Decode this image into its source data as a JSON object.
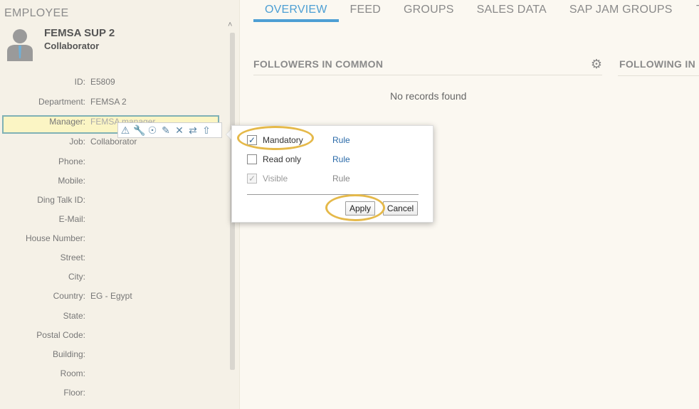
{
  "employee": {
    "section_title": "EMPLOYEE",
    "name": "FEMSA SUP 2",
    "role": "Collaborator",
    "fields": [
      {
        "label": "ID:",
        "value": "E5809"
      },
      {
        "label": "Department:",
        "value": "FEMSA 2"
      },
      {
        "label": "Manager:",
        "value": "FEMSA manager"
      },
      {
        "label": "Job:",
        "value": "Collaborator"
      },
      {
        "label": "Phone:",
        "value": ""
      },
      {
        "label": "Mobile:",
        "value": ""
      },
      {
        "label": "Ding Talk ID:",
        "value": ""
      },
      {
        "label": "E-Mail:",
        "value": ""
      },
      {
        "label": "House Number:",
        "value": ""
      },
      {
        "label": "Street:",
        "value": ""
      },
      {
        "label": "City:",
        "value": ""
      },
      {
        "label": "Country:",
        "value": "EG - Egypt"
      },
      {
        "label": "State:",
        "value": ""
      },
      {
        "label": "Postal Code:",
        "value": ""
      },
      {
        "label": "Building:",
        "value": ""
      },
      {
        "label": "Room:",
        "value": ""
      },
      {
        "label": "Floor:",
        "value": ""
      }
    ]
  },
  "toolbar_icons": [
    "warning-icon",
    "wrench-icon",
    "target-icon",
    "pencil-icon",
    "delete-icon",
    "move-icon",
    "arrow-up-icon"
  ],
  "tabs": [
    "OVERVIEW",
    "FEED",
    "GROUPS",
    "SALES DATA",
    "SAP JAM GROUPS"
  ],
  "tab_overflow": "T",
  "main": {
    "followers_title": "FOLLOWERS IN COMMON",
    "following_title": "FOLLOWING IN",
    "empty_text": "No records found"
  },
  "popup": {
    "options": [
      {
        "label": "Mandatory",
        "checked": true,
        "rule": "Rule"
      },
      {
        "label": "Read only",
        "checked": false,
        "rule": "Rule"
      },
      {
        "label": "Visible",
        "checked": true,
        "rule": "Rule",
        "disabled": true
      }
    ],
    "apply_label": "Apply",
    "cancel_label": "Cancel"
  },
  "colors": {
    "accent": "#4d9fd4",
    "highlight_ring": "#e5b94a",
    "manager_highlight": "#fbf5c4"
  }
}
